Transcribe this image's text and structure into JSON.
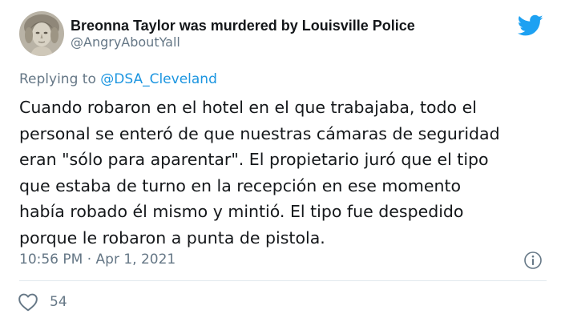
{
  "author": {
    "display_name": "Breonna Taylor was murdered by Louisville Police",
    "handle": "@AngryAboutYall",
    "avatar_icon": "statue-avatar"
  },
  "platform_icon": "twitter-bird-icon",
  "reply": {
    "prefix": "Replying to ",
    "mention": "@DSA_Cleveland"
  },
  "body_lines": [
    "Cuando robaron en el hotel en el que trabajaba, todo el",
    "personal se enteró de que nuestras cámaras de seguridad",
    "eran \"sólo para aparentar\". El propietario juró que el tipo",
    "que estaba de turno en la recepción en ese momento",
    "había robado él mismo y mintió. El tipo fue despedido",
    "porque le robaron a punta de pistola."
  ],
  "timestamp": "10:56 PM · Apr 1, 2021",
  "likes": "54",
  "colors": {
    "twitter_blue": "#1da1f2",
    "mention_blue": "#1b95e0",
    "muted_gray": "#657786",
    "text_dark": "#14171a",
    "divider": "#e1e8ed"
  }
}
